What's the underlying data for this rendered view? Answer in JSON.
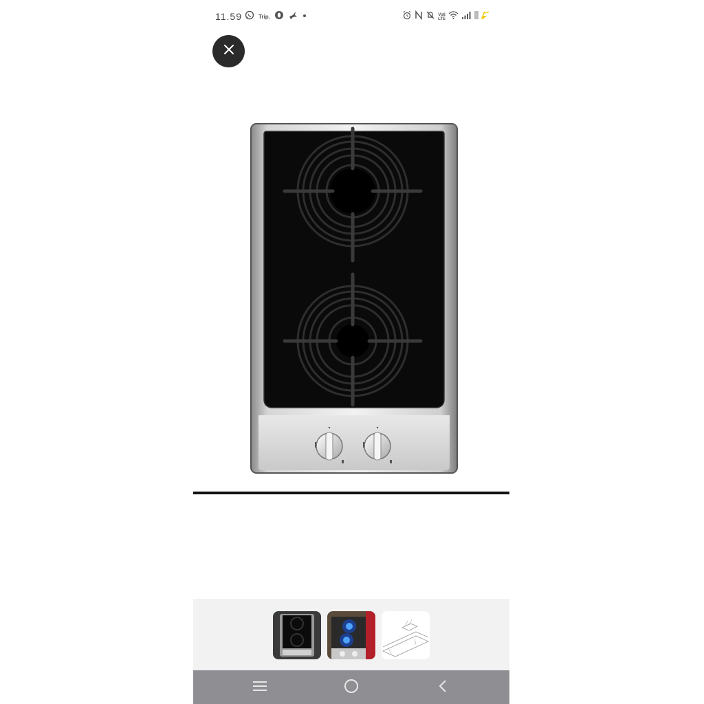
{
  "status_bar": {
    "time": "11.59",
    "trip_label": "Trip.",
    "volte_line1": "Vo8",
    "volte_line2": "LTE"
  },
  "viewer": {
    "close_label": "close",
    "image_count": 3,
    "selected_index": 0
  },
  "thumbnails": [
    {
      "name": "gas-hob-front-view"
    },
    {
      "name": "gas-hob-lit-burners"
    },
    {
      "name": "gas-hob-installation-diagram"
    }
  ],
  "colors": {
    "accent": "#26b7a5",
    "nav_bar": "#8e8e93",
    "close_button": "#2b2b2b"
  },
  "icons": {
    "whatsapp": "whatsapp-icon",
    "opera": "opera-icon",
    "bird": "bird-icon",
    "alarm": "alarm-icon",
    "nfc": "nfc-icon",
    "mute": "mute-icon",
    "wifi": "wifi-icon",
    "signal": "signal-icon",
    "battery": "battery-icon"
  }
}
